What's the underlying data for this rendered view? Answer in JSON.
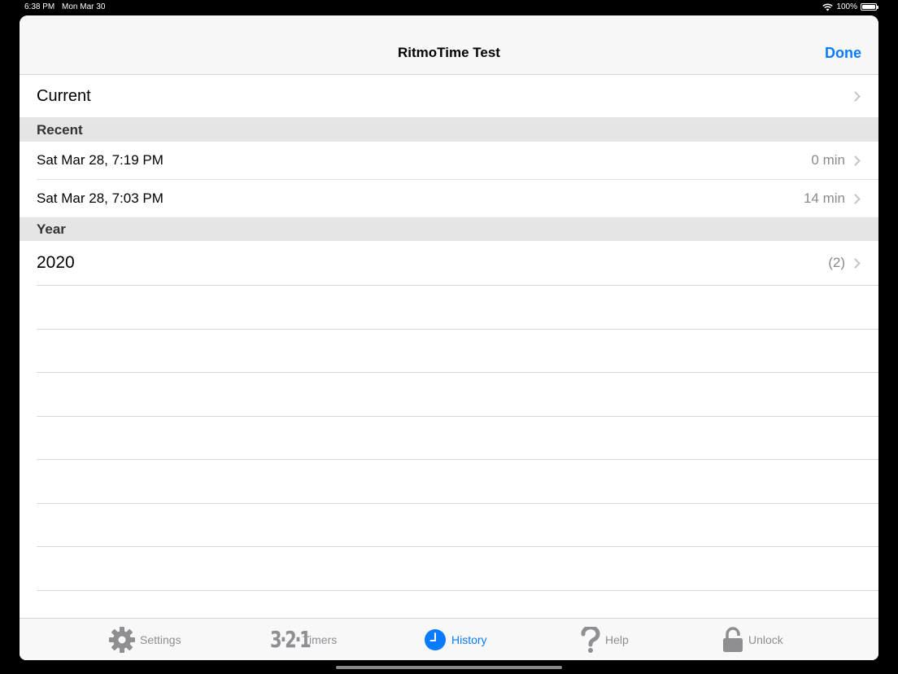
{
  "status_bar": {
    "time": "6:38 PM",
    "date": "Mon Mar 30",
    "battery": "100%"
  },
  "navbar": {
    "title": "RitmoTime Test",
    "done_label": "Done"
  },
  "current": {
    "label": "Current"
  },
  "sections": {
    "recent_header": "Recent",
    "year_header": "Year"
  },
  "recent_items": [
    {
      "label": "Sat Mar 28, 7:19 PM",
      "duration": "0 min"
    },
    {
      "label": "Sat Mar 28, 7:03 PM",
      "duration": "14 min"
    }
  ],
  "year_items": [
    {
      "label": "2020",
      "count": "(2)"
    }
  ],
  "tabs": [
    {
      "label": "Settings",
      "icon": "gear-icon",
      "active": false
    },
    {
      "label": "Timers",
      "icon": "321-icon",
      "glyph": "3·2·1",
      "active": false
    },
    {
      "label": "History",
      "icon": "clock-icon",
      "active": true
    },
    {
      "label": "Help",
      "icon": "question-icon",
      "active": false
    },
    {
      "label": "Unlock",
      "icon": "lock-icon",
      "active": false
    }
  ],
  "colors": {
    "accent": "#0a7aff",
    "inactive": "#8e8e93",
    "section_bg": "#e5e5e5"
  }
}
